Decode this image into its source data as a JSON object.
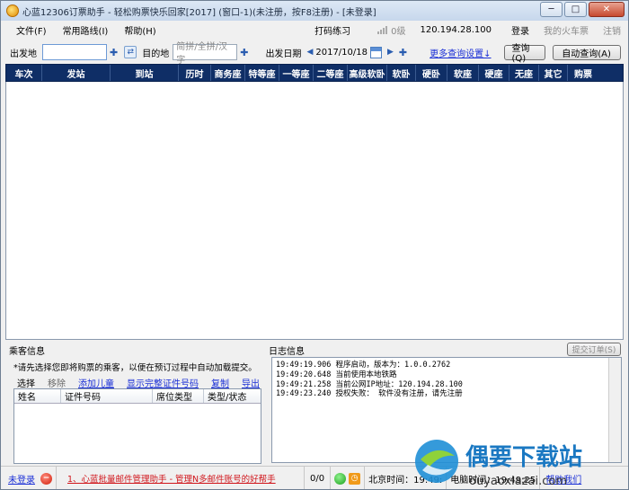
{
  "window": {
    "title": "心蓝12306订票助手 - 轻松购票快乐回家[2017] (窗口-1)(未注册，按F8注册) - [未登录]",
    "minimize_glyph": "─",
    "restore_glyph": "□",
    "close_glyph": "✕"
  },
  "menubar": {
    "items": [
      "文件(F)",
      "常用路线(I)",
      "帮助(H)"
    ],
    "right": {
      "typing_practice": "打码练习",
      "level": "0级",
      "ip": "120.194.28.100",
      "login": "登录",
      "my_tickets": "我的火车票",
      "logout": "注销"
    }
  },
  "toolbar": {
    "from_label": "出发地",
    "from_value": "",
    "to_label": "目的地",
    "to_placeholder": "简拼/全拼/汉字",
    "date_label": "出发日期",
    "date_value": "2017/10/18",
    "more_settings": "更多查询设置↓",
    "query_button": "查询(Q)",
    "auto_query_button": "自动查询(A)"
  },
  "train_table": {
    "columns": [
      "车次",
      "发站",
      "到站",
      "历时",
      "商务座",
      "特等座",
      "一等座",
      "二等座",
      "高级软卧",
      "软卧",
      "硬卧",
      "软座",
      "硬座",
      "无座",
      "其它",
      "购票"
    ],
    "rows": []
  },
  "passenger": {
    "title": "乘客信息",
    "hint": "*请先选择您即将购票的乘客，以便在预订过程中自动加载提交。",
    "actions": {
      "select": "选择",
      "remove": "移除",
      "add_child": "添加儿童",
      "show_full_id": "显示完整证件号码",
      "copy": "复制",
      "export": "导出"
    },
    "columns": [
      "姓名",
      "证件号码",
      "席位类型",
      "类型/状态"
    ]
  },
  "log": {
    "title": "日志信息",
    "submit_button": "提交订单(S)",
    "lines": [
      "19:49:19.906 程序启动，版本为：1.0.0.2762",
      "19:49:20.648 当前使用本地铁路",
      "19:49:21.258 当前公网IP地址：120.194.28.100",
      "19:49:23.240 授权失败： 软件没有注册，请先注册"
    ]
  },
  "statusbar": {
    "login_status": "未登录",
    "promo": "1、心蓝批量邮件管理助手 - 管理N多邮件账号的好帮手",
    "count": "0/0",
    "beijing_time": "北京时间：19:49:",
    "pc_time": "电脑时间：19:49:25",
    "help": "帮助我们"
  },
  "watermark": {
    "main": "偶要下载站",
    "url": "ouyaoxiazai.com"
  }
}
